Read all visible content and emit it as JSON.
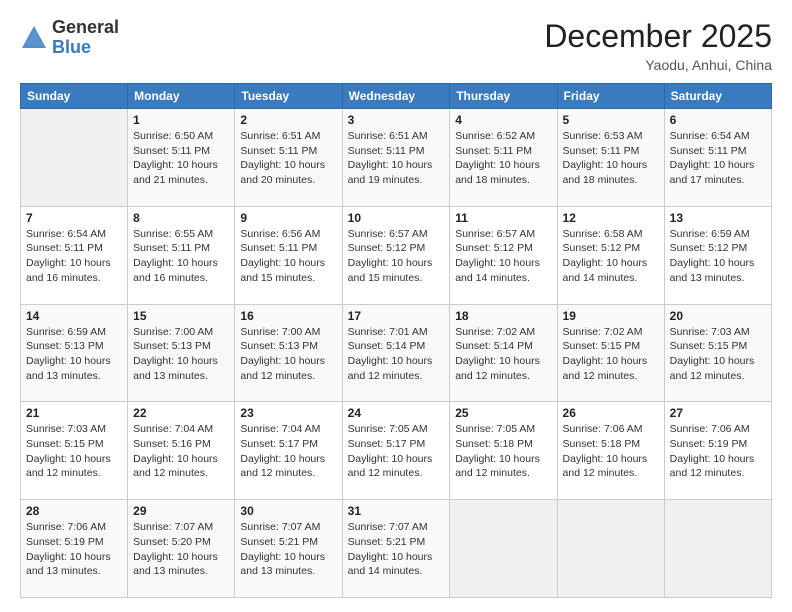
{
  "logo": {
    "general": "General",
    "blue": "Blue"
  },
  "header": {
    "month": "December 2025",
    "location": "Yaodu, Anhui, China"
  },
  "weekdays": [
    "Sunday",
    "Monday",
    "Tuesday",
    "Wednesday",
    "Thursday",
    "Friday",
    "Saturday"
  ],
  "weeks": [
    [
      {
        "day": "",
        "sunrise": "",
        "sunset": "",
        "daylight": ""
      },
      {
        "day": "1",
        "sunrise": "Sunrise: 6:50 AM",
        "sunset": "Sunset: 5:11 PM",
        "daylight": "Daylight: 10 hours and 21 minutes."
      },
      {
        "day": "2",
        "sunrise": "Sunrise: 6:51 AM",
        "sunset": "Sunset: 5:11 PM",
        "daylight": "Daylight: 10 hours and 20 minutes."
      },
      {
        "day": "3",
        "sunrise": "Sunrise: 6:51 AM",
        "sunset": "Sunset: 5:11 PM",
        "daylight": "Daylight: 10 hours and 19 minutes."
      },
      {
        "day": "4",
        "sunrise": "Sunrise: 6:52 AM",
        "sunset": "Sunset: 5:11 PM",
        "daylight": "Daylight: 10 hours and 18 minutes."
      },
      {
        "day": "5",
        "sunrise": "Sunrise: 6:53 AM",
        "sunset": "Sunset: 5:11 PM",
        "daylight": "Daylight: 10 hours and 18 minutes."
      },
      {
        "day": "6",
        "sunrise": "Sunrise: 6:54 AM",
        "sunset": "Sunset: 5:11 PM",
        "daylight": "Daylight: 10 hours and 17 minutes."
      }
    ],
    [
      {
        "day": "7",
        "sunrise": "Sunrise: 6:54 AM",
        "sunset": "Sunset: 5:11 PM",
        "daylight": "Daylight: 10 hours and 16 minutes."
      },
      {
        "day": "8",
        "sunrise": "Sunrise: 6:55 AM",
        "sunset": "Sunset: 5:11 PM",
        "daylight": "Daylight: 10 hours and 16 minutes."
      },
      {
        "day": "9",
        "sunrise": "Sunrise: 6:56 AM",
        "sunset": "Sunset: 5:11 PM",
        "daylight": "Daylight: 10 hours and 15 minutes."
      },
      {
        "day": "10",
        "sunrise": "Sunrise: 6:57 AM",
        "sunset": "Sunset: 5:12 PM",
        "daylight": "Daylight: 10 hours and 15 minutes."
      },
      {
        "day": "11",
        "sunrise": "Sunrise: 6:57 AM",
        "sunset": "Sunset: 5:12 PM",
        "daylight": "Daylight: 10 hours and 14 minutes."
      },
      {
        "day": "12",
        "sunrise": "Sunrise: 6:58 AM",
        "sunset": "Sunset: 5:12 PM",
        "daylight": "Daylight: 10 hours and 14 minutes."
      },
      {
        "day": "13",
        "sunrise": "Sunrise: 6:59 AM",
        "sunset": "Sunset: 5:12 PM",
        "daylight": "Daylight: 10 hours and 13 minutes."
      }
    ],
    [
      {
        "day": "14",
        "sunrise": "Sunrise: 6:59 AM",
        "sunset": "Sunset: 5:13 PM",
        "daylight": "Daylight: 10 hours and 13 minutes."
      },
      {
        "day": "15",
        "sunrise": "Sunrise: 7:00 AM",
        "sunset": "Sunset: 5:13 PM",
        "daylight": "Daylight: 10 hours and 13 minutes."
      },
      {
        "day": "16",
        "sunrise": "Sunrise: 7:00 AM",
        "sunset": "Sunset: 5:13 PM",
        "daylight": "Daylight: 10 hours and 12 minutes."
      },
      {
        "day": "17",
        "sunrise": "Sunrise: 7:01 AM",
        "sunset": "Sunset: 5:14 PM",
        "daylight": "Daylight: 10 hours and 12 minutes."
      },
      {
        "day": "18",
        "sunrise": "Sunrise: 7:02 AM",
        "sunset": "Sunset: 5:14 PM",
        "daylight": "Daylight: 10 hours and 12 minutes."
      },
      {
        "day": "19",
        "sunrise": "Sunrise: 7:02 AM",
        "sunset": "Sunset: 5:15 PM",
        "daylight": "Daylight: 10 hours and 12 minutes."
      },
      {
        "day": "20",
        "sunrise": "Sunrise: 7:03 AM",
        "sunset": "Sunset: 5:15 PM",
        "daylight": "Daylight: 10 hours and 12 minutes."
      }
    ],
    [
      {
        "day": "21",
        "sunrise": "Sunrise: 7:03 AM",
        "sunset": "Sunset: 5:15 PM",
        "daylight": "Daylight: 10 hours and 12 minutes."
      },
      {
        "day": "22",
        "sunrise": "Sunrise: 7:04 AM",
        "sunset": "Sunset: 5:16 PM",
        "daylight": "Daylight: 10 hours and 12 minutes."
      },
      {
        "day": "23",
        "sunrise": "Sunrise: 7:04 AM",
        "sunset": "Sunset: 5:17 PM",
        "daylight": "Daylight: 10 hours and 12 minutes."
      },
      {
        "day": "24",
        "sunrise": "Sunrise: 7:05 AM",
        "sunset": "Sunset: 5:17 PM",
        "daylight": "Daylight: 10 hours and 12 minutes."
      },
      {
        "day": "25",
        "sunrise": "Sunrise: 7:05 AM",
        "sunset": "Sunset: 5:18 PM",
        "daylight": "Daylight: 10 hours and 12 minutes."
      },
      {
        "day": "26",
        "sunrise": "Sunrise: 7:06 AM",
        "sunset": "Sunset: 5:18 PM",
        "daylight": "Daylight: 10 hours and 12 minutes."
      },
      {
        "day": "27",
        "sunrise": "Sunrise: 7:06 AM",
        "sunset": "Sunset: 5:19 PM",
        "daylight": "Daylight: 10 hours and 12 minutes."
      }
    ],
    [
      {
        "day": "28",
        "sunrise": "Sunrise: 7:06 AM",
        "sunset": "Sunset: 5:19 PM",
        "daylight": "Daylight: 10 hours and 13 minutes."
      },
      {
        "day": "29",
        "sunrise": "Sunrise: 7:07 AM",
        "sunset": "Sunset: 5:20 PM",
        "daylight": "Daylight: 10 hours and 13 minutes."
      },
      {
        "day": "30",
        "sunrise": "Sunrise: 7:07 AM",
        "sunset": "Sunset: 5:21 PM",
        "daylight": "Daylight: 10 hours and 13 minutes."
      },
      {
        "day": "31",
        "sunrise": "Sunrise: 7:07 AM",
        "sunset": "Sunset: 5:21 PM",
        "daylight": "Daylight: 10 hours and 14 minutes."
      },
      {
        "day": "",
        "sunrise": "",
        "sunset": "",
        "daylight": ""
      },
      {
        "day": "",
        "sunrise": "",
        "sunset": "",
        "daylight": ""
      },
      {
        "day": "",
        "sunrise": "",
        "sunset": "",
        "daylight": ""
      }
    ]
  ]
}
